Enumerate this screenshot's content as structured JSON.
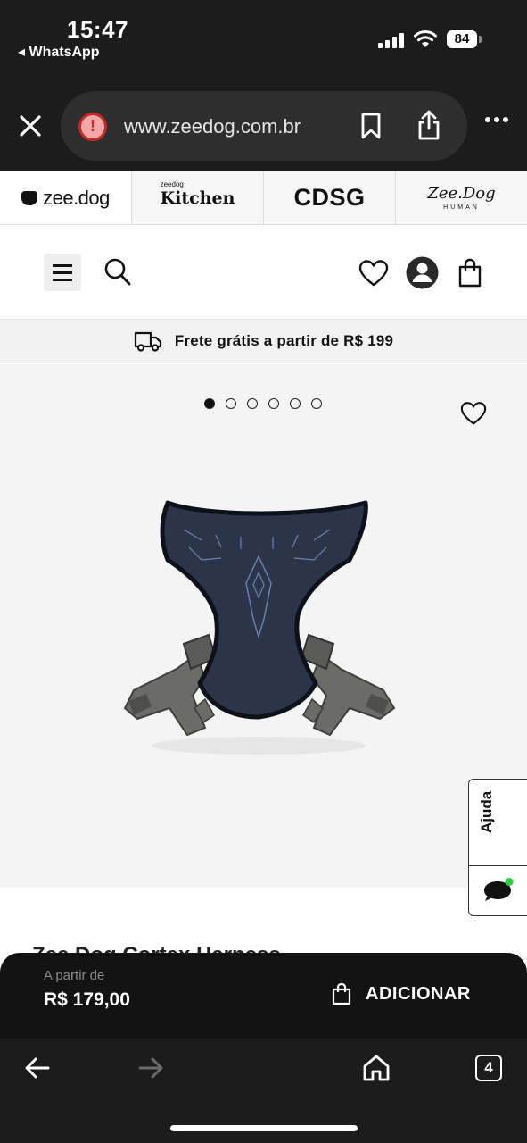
{
  "status_bar": {
    "time": "15:47",
    "back_app": "◂ WhatsApp",
    "battery": "84",
    "signal_icon": "cellular-signal-icon",
    "wifi_icon": "wifi-icon"
  },
  "browser": {
    "url": "www.zeedog.com.br",
    "security_icon": "warning-icon",
    "tabs_count": "4"
  },
  "brands": [
    {
      "label": "zee.dog",
      "active": true
    },
    {
      "label": "Kitchen",
      "prefix": "zeedog"
    },
    {
      "label": "CDSG"
    },
    {
      "label": "Zee.Dog",
      "sub": "HUMAN"
    }
  ],
  "shipping_banner": {
    "text": "Frete grátis a partir de R$ 199",
    "icon": "truck-icon"
  },
  "gallery": {
    "image_count": 6,
    "active_index": 0,
    "product_image": "dog-harness"
  },
  "help_widget": {
    "label": "Ajuda",
    "icon": "chat-bubble-icon",
    "status_color": "#2ecc40"
  },
  "product": {
    "title_partial": "Zee.Dog Cortex Harness"
  },
  "buy_bar": {
    "price_label": "A partir de",
    "price": "R$ 179,00",
    "add_label": "ADICIONAR"
  },
  "colors": {
    "browser_chrome": "#1c1c1c",
    "buy_bar": "#131313",
    "harness_navy": "#2b3448",
    "harness_strap": "#6b6b68"
  }
}
